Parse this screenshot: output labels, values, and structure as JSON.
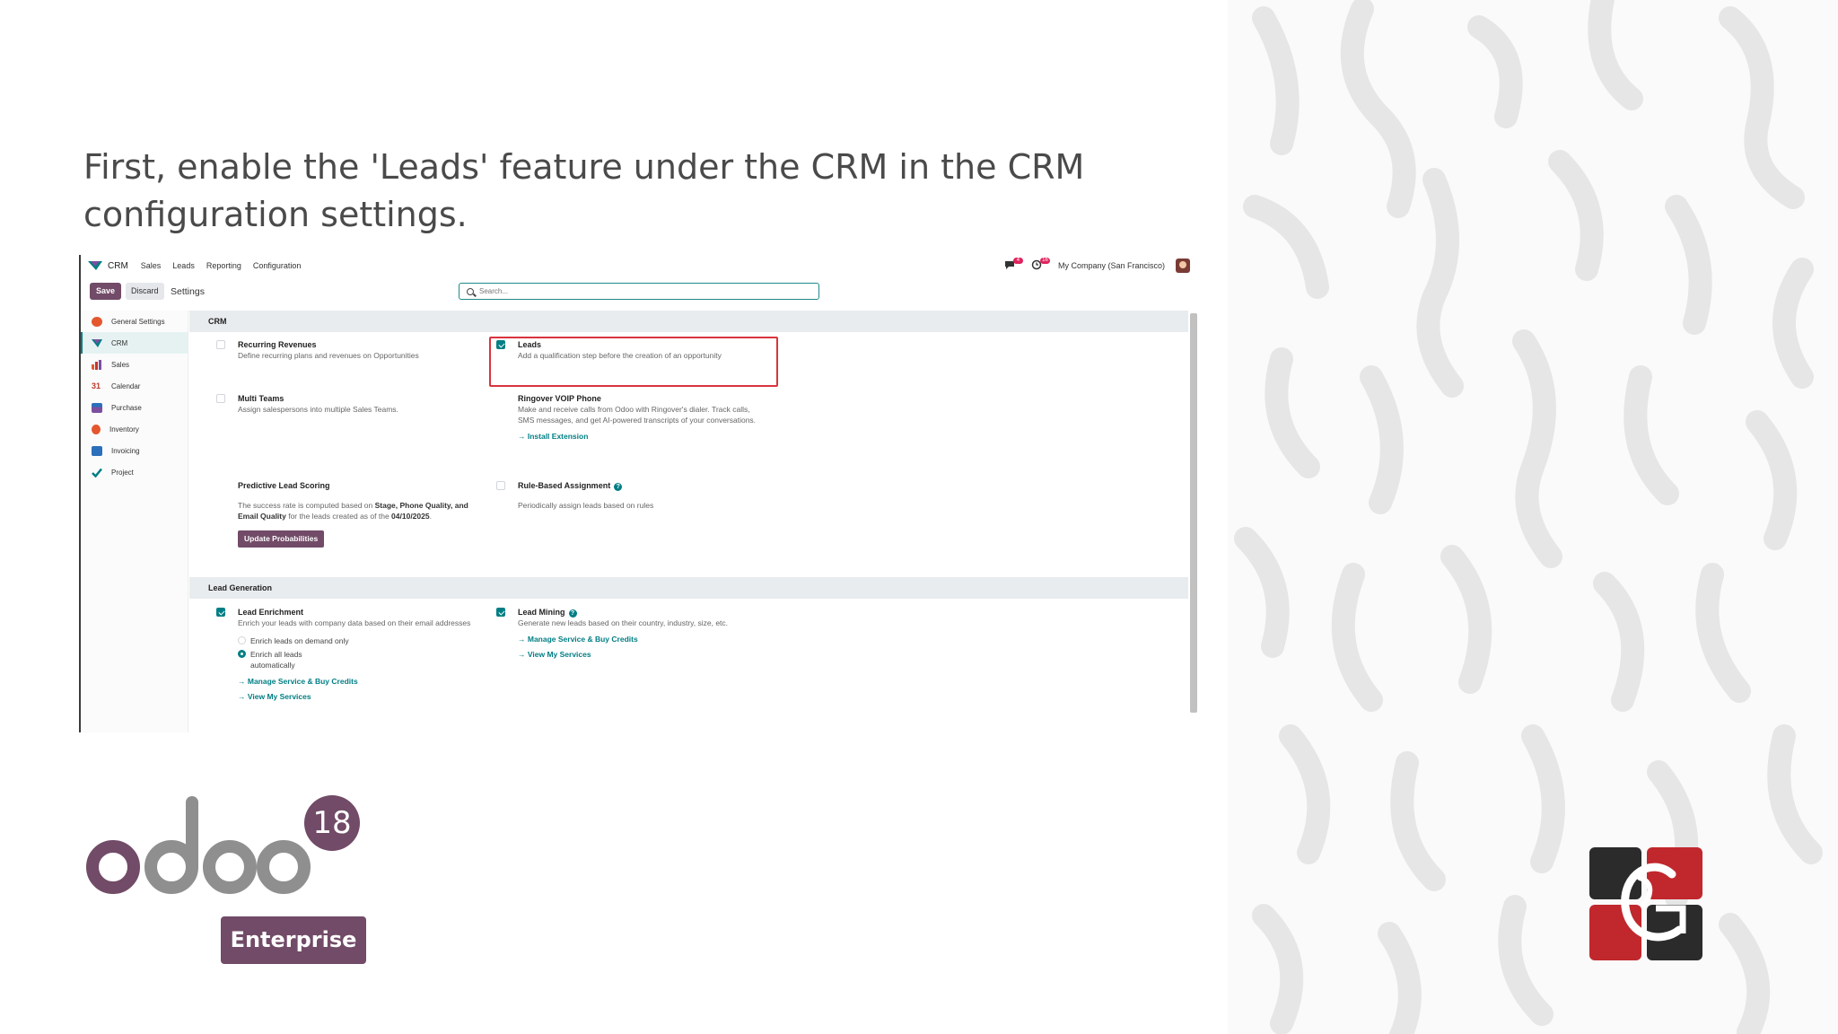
{
  "slide": {
    "headline": "First, enable the 'Leads' feature under the CRM in the CRM configuration settings.",
    "version_badge": "18",
    "edition_badge": "Enterprise",
    "logo_wordmark": "odoo"
  },
  "app": {
    "topnav": {
      "app_name": "CRM",
      "menu_items": [
        "Sales",
        "Leads",
        "Reporting",
        "Configuration"
      ],
      "chat_badge": "4",
      "activity_badge": "16",
      "company": "My Company (San Francisco)"
    },
    "controls": {
      "save_label": "Save",
      "discard_label": "Discard",
      "breadcrumb": "Settings",
      "search_placeholder": "Search..."
    },
    "sidebar": {
      "items": [
        {
          "label": "General Settings",
          "icon": "settings-icon",
          "color": "#e4572e"
        },
        {
          "label": "CRM",
          "icon": "crm-icon",
          "color": "#017e84"
        },
        {
          "label": "Sales",
          "icon": "sales-icon",
          "color": "#e4572e"
        },
        {
          "label": "Calendar",
          "icon": "calendar-icon",
          "color": "#c0392b"
        },
        {
          "label": "Purchase",
          "icon": "purchase-icon",
          "color": "#7b4f9e"
        },
        {
          "label": "Inventory",
          "icon": "inventory-icon",
          "color": "#e4572e"
        },
        {
          "label": "Invoicing",
          "icon": "invoicing-icon",
          "color": "#2c6fbb"
        },
        {
          "label": "Project",
          "icon": "project-icon",
          "color": "#017e84"
        }
      ]
    },
    "sections": {
      "crm": {
        "title": "CRM",
        "recurring": {
          "title": "Recurring Revenues",
          "desc": "Define recurring plans and revenues on Opportunities",
          "checked": false
        },
        "leads": {
          "title": "Leads",
          "desc": "Add a qualification step before the creation of an opportunity",
          "checked": true
        },
        "multi_teams": {
          "title": "Multi Teams",
          "desc": "Assign salespersons into multiple Sales Teams.",
          "checked": false
        },
        "voip": {
          "title": "Ringover VOIP Phone",
          "desc": "Make and receive calls from Odoo with Ringover's dialer. Track calls, SMS messages, and get AI-powered transcripts of your conversations.",
          "link": "→ Install Extension"
        },
        "predictive": {
          "title": "Predictive Lead Scoring",
          "desc_prefix": "The success rate is computed based on ",
          "desc_bold1": "Stage, Phone Quality, and Email Quality",
          "desc_mid": " for the leads created as of the ",
          "desc_bold2": "04/10/2025",
          "desc_suffix": ".",
          "button": "Update Probabilities"
        },
        "rule_based": {
          "title": "Rule-Based Assignment",
          "desc": "Periodically assign leads based on rules",
          "checked": false
        }
      },
      "lead_generation": {
        "title": "Lead Generation",
        "enrichment": {
          "title": "Lead Enrichment",
          "desc": "Enrich your leads with company data based on their email addresses",
          "checked": true,
          "radio_1": "Enrich leads on demand only",
          "radio_2": "Enrich all leads automatically",
          "link_1": "→ Manage Service & Buy Credits",
          "link_2": "→ View My Services"
        },
        "mining": {
          "title": "Lead Mining",
          "desc": "Generate new leads based on their country, industry, size, etc.",
          "checked": true,
          "link_1": "→ Manage Service & Buy Credits",
          "link_2": "→ View My Services"
        }
      }
    }
  },
  "colors": {
    "brand_purple": "#714b67",
    "odoo_teal": "#017e84",
    "highlight_red": "#d9343e"
  }
}
